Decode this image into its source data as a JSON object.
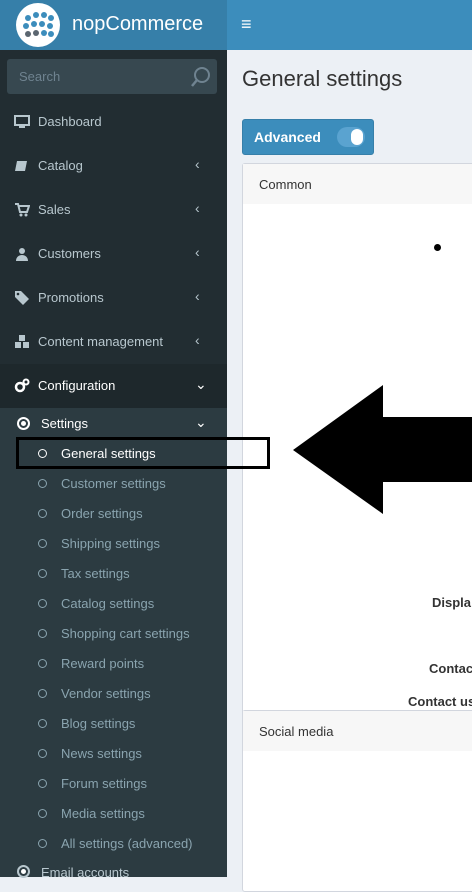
{
  "app": {
    "name": "nopCommerce"
  },
  "search": {
    "placeholder": "Search"
  },
  "sidebar": {
    "items": [
      {
        "label": "Dashboard",
        "icon": "monitor-icon"
      },
      {
        "label": "Catalog",
        "icon": "book-icon"
      },
      {
        "label": "Sales",
        "icon": "cart-icon"
      },
      {
        "label": "Customers",
        "icon": "user-icon"
      },
      {
        "label": "Promotions",
        "icon": "tags-icon"
      },
      {
        "label": "Content management",
        "icon": "cubes-icon"
      },
      {
        "label": "Configuration",
        "icon": "gears-icon"
      }
    ],
    "settings_label": "Settings",
    "settings_sub": [
      "General settings",
      "Customer settings",
      "Order settings",
      "Shipping settings",
      "Tax settings",
      "Catalog settings",
      "Shopping cart settings",
      "Reward points",
      "Vendor settings",
      "Blog settings",
      "News settings",
      "Forum settings",
      "Media settings",
      "All settings (advanced)"
    ],
    "email_accounts": "Email accounts"
  },
  "page": {
    "title": "General settings",
    "advanced_label": "Advanced",
    "cards": [
      {
        "title": "Common",
        "fields": [
          "Displa",
          "Contac",
          "Contact us"
        ]
      },
      {
        "title": "Social media"
      }
    ]
  },
  "colors": {
    "sidebar": "#222d32",
    "header": "#3c8dbc",
    "logo": "#367fa9"
  }
}
